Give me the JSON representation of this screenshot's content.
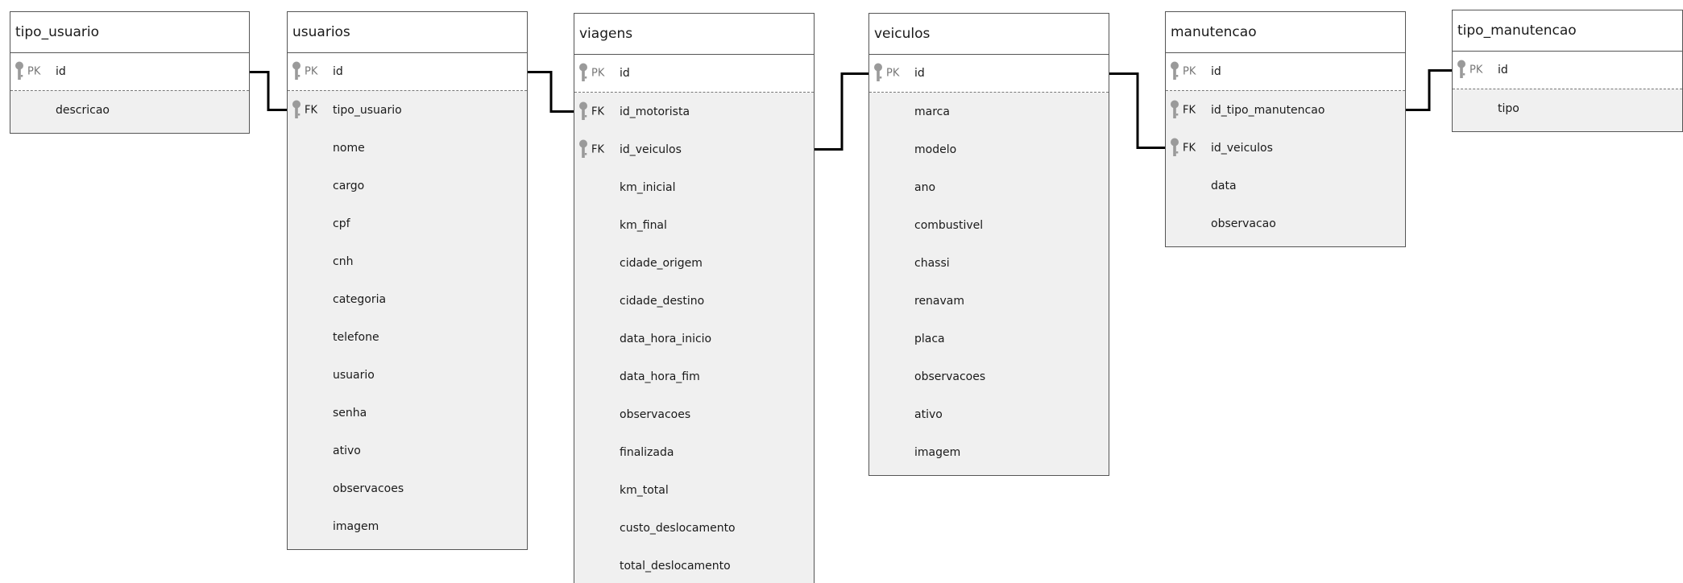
{
  "entities": [
    {
      "id": "tipo_usuario",
      "title": "tipo_usuario",
      "pk": {
        "key": "PK",
        "name": "id"
      },
      "columns": [
        {
          "key": "",
          "name": "descricao"
        }
      ]
    },
    {
      "id": "usuarios",
      "title": "usuarios",
      "pk": {
        "key": "PK",
        "name": "id"
      },
      "columns": [
        {
          "key": "FK",
          "name": "tipo_usuario"
        },
        {
          "key": "",
          "name": "nome"
        },
        {
          "key": "",
          "name": "cargo"
        },
        {
          "key": "",
          "name": "cpf"
        },
        {
          "key": "",
          "name": "cnh"
        },
        {
          "key": "",
          "name": "categoria"
        },
        {
          "key": "",
          "name": "telefone"
        },
        {
          "key": "",
          "name": "usuario"
        },
        {
          "key": "",
          "name": "senha"
        },
        {
          "key": "",
          "name": "ativo"
        },
        {
          "key": "",
          "name": "observacoes"
        },
        {
          "key": "",
          "name": "imagem"
        }
      ]
    },
    {
      "id": "viagens",
      "title": "viagens",
      "pk": {
        "key": "PK",
        "name": "id"
      },
      "columns": [
        {
          "key": "FK",
          "name": "id_motorista"
        },
        {
          "key": "FK",
          "name": "id_veiculos"
        },
        {
          "key": "",
          "name": "km_inicial"
        },
        {
          "key": "",
          "name": "km_final"
        },
        {
          "key": "",
          "name": "cidade_origem"
        },
        {
          "key": "",
          "name": "cidade_destino"
        },
        {
          "key": "",
          "name": "data_hora_inicio"
        },
        {
          "key": "",
          "name": "data_hora_fim"
        },
        {
          "key": "",
          "name": "observacoes"
        },
        {
          "key": "",
          "name": "finalizada"
        },
        {
          "key": "",
          "name": "km_total"
        },
        {
          "key": "",
          "name": "custo_deslocamento"
        },
        {
          "key": "",
          "name": "total_deslocamento"
        }
      ]
    },
    {
      "id": "veiculos",
      "title": "veiculos",
      "pk": {
        "key": "PK",
        "name": "id"
      },
      "columns": [
        {
          "key": "",
          "name": "marca"
        },
        {
          "key": "",
          "name": "modelo"
        },
        {
          "key": "",
          "name": "ano"
        },
        {
          "key": "",
          "name": "combustivel"
        },
        {
          "key": "",
          "name": "chassi"
        },
        {
          "key": "",
          "name": "renavam"
        },
        {
          "key": "",
          "name": "placa"
        },
        {
          "key": "",
          "name": "observacoes"
        },
        {
          "key": "",
          "name": "ativo"
        },
        {
          "key": "",
          "name": "imagem"
        }
      ]
    },
    {
      "id": "manutencao",
      "title": "manutencao",
      "pk": {
        "key": "PK",
        "name": "id"
      },
      "columns": [
        {
          "key": "FK",
          "name": "id_tipo_manutencao"
        },
        {
          "key": "FK",
          "name": "id_veiculos"
        },
        {
          "key": "",
          "name": "data"
        },
        {
          "key": "",
          "name": "observacao"
        }
      ]
    },
    {
      "id": "tipo_manutencao",
      "title": "tipo_manutencao",
      "pk": {
        "key": "PK",
        "name": "id"
      },
      "columns": [
        {
          "key": "",
          "name": "tipo"
        }
      ]
    }
  ],
  "relationships": [
    {
      "from": "tipo_usuario.id",
      "to": "usuarios.tipo_usuario"
    },
    {
      "from": "usuarios.id",
      "to": "viagens.id_motorista"
    },
    {
      "from": "veiculos.id",
      "to": "viagens.id_veiculos"
    },
    {
      "from": "veiculos.id",
      "to": "manutencao.id_veiculos"
    },
    {
      "from": "tipo_manutencao.id",
      "to": "manutencao.id_tipo_manutencao"
    }
  ],
  "colors": {
    "line": "#000000",
    "border": "#555555",
    "body_fill": "#f0f0f0",
    "key_icon": "#9a9a9a"
  }
}
